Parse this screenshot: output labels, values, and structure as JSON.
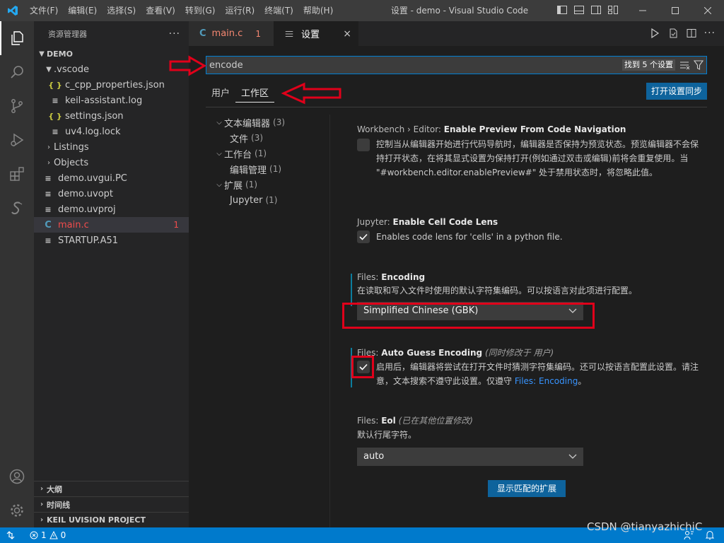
{
  "window": {
    "title": "设置 - demo - Visual Studio Code",
    "menu": [
      "文件(F)",
      "编辑(E)",
      "选择(S)",
      "查看(V)",
      "转到(G)",
      "运行(R)",
      "终端(T)",
      "帮助(H)"
    ]
  },
  "activity_bar": {
    "items": [
      "explorer-icon",
      "search-icon",
      "source-control-icon",
      "run-debug-icon",
      "extensions-icon",
      "extension-s-icon"
    ],
    "bottom": [
      "account-icon",
      "manage-gear-icon"
    ]
  },
  "sidebar": {
    "title": "资源管理器",
    "more": "···",
    "workspace": "DEMO",
    "tree": [
      {
        "label": ".vscode",
        "type": "folder-open"
      },
      {
        "label": "c_cpp_properties.json",
        "icon": "{ }"
      },
      {
        "label": "keil-assistant.log",
        "icon": "≡"
      },
      {
        "label": "settings.json",
        "icon": "{ }"
      },
      {
        "label": "uv4.log.lock",
        "icon": "≡"
      },
      {
        "label": "Listings",
        "type": "folder"
      },
      {
        "label": "Objects",
        "type": "folder"
      },
      {
        "label": "demo.uvgui.PC",
        "icon": "≡"
      },
      {
        "label": "demo.uvopt",
        "icon": "≡"
      },
      {
        "label": "demo.uvproj",
        "icon": "≡"
      },
      {
        "label": "main.c",
        "icon": "C",
        "badge": "1"
      },
      {
        "label": "STARTUP.A51",
        "icon": "≡"
      }
    ],
    "sections": [
      "大纲",
      "时间线",
      "KEIL UVISION PROJECT"
    ]
  },
  "tabs": [
    {
      "label": "main.c",
      "badge": "1",
      "icon": "C"
    },
    {
      "label": "设置",
      "close": "×"
    }
  ],
  "settings": {
    "search": {
      "value": "encode",
      "count": "找到 5 个设置"
    },
    "scope_tabs": [
      "用户",
      "工作区"
    ],
    "sync_button": "打开设置同步",
    "toc": [
      {
        "label": "文本编辑器",
        "count": "(3)"
      },
      {
        "label": "文件",
        "count": "(3)"
      },
      {
        "label": "工作台",
        "count": "(1)"
      },
      {
        "label": "编辑管理",
        "count": "(1)"
      },
      {
        "label": "扩展",
        "count": "(1)"
      },
      {
        "label": "Jupyter",
        "count": "(1)"
      }
    ],
    "items": [
      {
        "category": "Workbench › Editor: ",
        "key": "Enable Preview From Code Navigation",
        "description": "控制当从编辑器开始进行代码导航时，编辑器是否保持为预览状态。预览编辑器不会保持打开状态，在将其显式设置为保持打开(例如通过双击或编辑)前将会重复使用。当 \"#workbench.editor.enablePreview#\" 处于禁用状态时，将忽略此值。",
        "checked": false
      },
      {
        "category": "Jupyter: ",
        "key": "Enable Cell Code Lens",
        "description": "Enables code lens for 'cells' in a python file.",
        "checked": true
      },
      {
        "category": "Files: ",
        "key": "Encoding",
        "description": "在读取和写入文件时使用的默认字符集编码。可以按语言对此项进行配置。",
        "value": "Simplified Chinese (GBK)"
      },
      {
        "category": "Files: ",
        "key": "Auto Guess Encoding",
        "scope_note": "(同时修改于 用户)",
        "description": "启用后，编辑器将尝试在打开文件时猜测字符集编码。还可以按语言配置此设置。请注意，文本搜索不遵守此设置。仅遵守 ",
        "link": "Files: Encoding",
        "after_link": "。",
        "checked": true
      },
      {
        "category": "Files: ",
        "key": "Eol",
        "scope_note": "(已在其他位置修改)",
        "description": "默认行尾字符。",
        "value": "auto"
      }
    ],
    "show_extensions_button": "显示匹配的扩展"
  },
  "statusbar": {
    "errors": "1",
    "warnings": "0"
  },
  "watermark": "CSDN @tianyazhichiC",
  "colors": {
    "accent": "#007acc",
    "button": "#0e639c",
    "annotation": "#e0001a",
    "error": "#f14c4c"
  }
}
